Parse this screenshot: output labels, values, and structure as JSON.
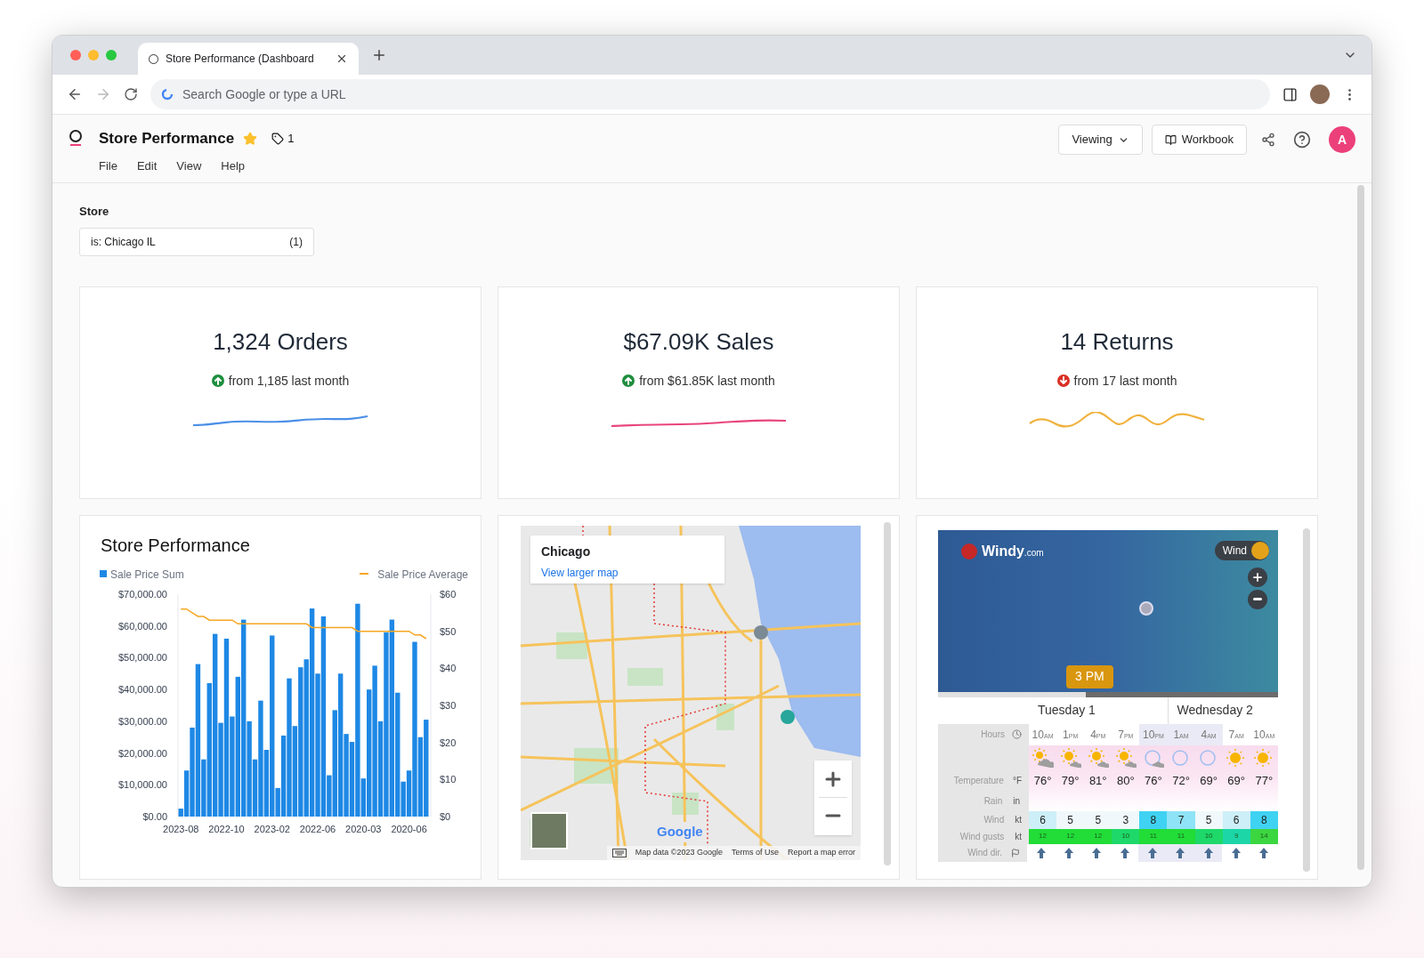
{
  "browser": {
    "tab_title": "Store Performance (Dashboard",
    "address_placeholder": "Search Google or type a URL"
  },
  "app": {
    "title": "Store Performance",
    "favorite": true,
    "tag_count": "1",
    "menu": [
      "File",
      "Edit",
      "View",
      "Help"
    ],
    "viewing": "Viewing",
    "workbook": "Workbook",
    "avatar": "A"
  },
  "filter": {
    "label": "Store",
    "value": "is: Chicago IL",
    "count": "(1)"
  },
  "kpis": [
    {
      "value": "1,324 Orders",
      "kind": "up",
      "comparison": "from 1,185 last month",
      "color": "#4a8fe7"
    },
    {
      "value": "$67.09K Sales",
      "kind": "up",
      "comparison": "from $61.85K last month",
      "color": "#e8457a"
    },
    {
      "value": "14 Returns",
      "kind": "down",
      "comparison": "from 17 last month",
      "color": "#f0b23e"
    }
  ],
  "chart_card": {
    "title": "Store Performance",
    "chart_data": {
      "type": "bar",
      "legend": "top",
      "ylim": [
        0,
        70000
      ],
      "y2lim": [
        0,
        60
      ],
      "categories": [
        "2023-08",
        null,
        null,
        null,
        null,
        null,
        null,
        null,
        "2022-10",
        null,
        null,
        null,
        null,
        null,
        null,
        null,
        "2023-02",
        null,
        null,
        null,
        null,
        null,
        null,
        null,
        "2022-06",
        null,
        null,
        null,
        null,
        null,
        null,
        null,
        "2020-03",
        null,
        null,
        null,
        null,
        null,
        null,
        null,
        "2020-06",
        null,
        null,
        null
      ],
      "yticks": [
        {
          "value": 0,
          "label": "$0.00"
        },
        {
          "value": 10000,
          "label": "$10,000.00"
        },
        {
          "value": 20000,
          "label": "$20,000.00"
        },
        {
          "value": 30000,
          "label": "$30,000.00"
        },
        {
          "value": 40000,
          "label": "$40,000.00"
        },
        {
          "value": 50000,
          "label": "$50,000.00"
        },
        {
          "value": 60000,
          "label": "$60,000.00"
        },
        {
          "value": 70000,
          "label": "$70,000.00"
        }
      ],
      "y2ticks": [
        {
          "value": 0,
          "label": "$0"
        },
        {
          "value": 10,
          "label": "$10"
        },
        {
          "value": 20,
          "label": "$20"
        },
        {
          "value": 30,
          "label": "$30"
        },
        {
          "value": 40,
          "label": "$40"
        },
        {
          "value": 50,
          "label": "$50"
        },
        {
          "value": 60,
          "label": "$60"
        }
      ],
      "series": [
        {
          "name": "Sale Price Sum",
          "color": "#1e88e5",
          "values": [
            2500,
            14500,
            28000,
            48000,
            18000,
            42000,
            57500,
            29500,
            56000,
            31500,
            44000,
            62000,
            30000,
            18000,
            36500,
            21000,
            57000,
            9000,
            25500,
            43500,
            28500,
            47000,
            49500,
            65500,
            45000,
            63000,
            13000,
            33500,
            45000,
            26000,
            23500,
            67000,
            12000,
            40000,
            47500,
            30000,
            58000,
            62000,
            39000,
            11000,
            14500,
            55000,
            25000,
            30500
          ]
        },
        {
          "name": "Sale Price Average",
          "color": "#f5a623",
          "type": "line",
          "axis": "y2",
          "values": [
            56,
            56,
            55,
            54,
            54,
            53,
            53,
            53,
            53,
            53,
            52,
            52,
            52,
            52,
            52,
            52,
            52,
            52,
            52,
            52,
            52,
            52,
            52,
            51,
            51,
            51,
            51,
            51,
            51,
            51,
            51,
            50,
            50,
            50,
            50,
            50,
            50,
            50,
            50,
            50,
            50,
            49,
            49,
            48
          ]
        }
      ]
    }
  },
  "map_card": {
    "place": "Chicago",
    "link": "View larger map",
    "logo": "Google",
    "footer": [
      "Map data ©2023 Google",
      "Terms of Use",
      "Report a map error"
    ]
  },
  "weather": {
    "brand": "Windy",
    "brand_suffix": ".com",
    "layer": "Wind",
    "time": "3 PM",
    "labels": {
      "hours": "Hours",
      "temperature": "Temperature",
      "temp_unit": "°F",
      "rain": "Rain",
      "rain_unit": "in",
      "wind": "Wind",
      "wind_unit": "kt",
      "gusts": "Wind gusts",
      "gusts_unit": "kt",
      "direction": "Wind dir."
    },
    "days": [
      {
        "label": "Tuesday 1",
        "hours": [
          {
            "hour": "10",
            "suffix": "AM",
            "kind": "cloudy-sun",
            "temp": "76°",
            "wind": "6",
            "gust": "12",
            "night": false
          },
          {
            "hour": "1",
            "suffix": "PM",
            "kind": "sun-cloud",
            "temp": "79°",
            "wind": "5",
            "gust": "12",
            "night": false
          },
          {
            "hour": "4",
            "suffix": "PM",
            "kind": "sun-cloud",
            "temp": "81°",
            "wind": "5",
            "gust": "12",
            "night": false
          },
          {
            "hour": "7",
            "suffix": "PM",
            "kind": "sun-cloud",
            "temp": "80°",
            "wind": "3",
            "gust": "10",
            "night": false
          },
          {
            "hour": "10",
            "suffix": "PM",
            "kind": "night-cloud",
            "temp": "76°",
            "wind": "8",
            "gust": "11",
            "night": true
          }
        ]
      },
      {
        "label": "Wednesday 2",
        "hours": [
          {
            "hour": "1",
            "suffix": "AM",
            "kind": "night",
            "temp": "72°",
            "wind": "7",
            "gust": "11",
            "night": true
          },
          {
            "hour": "4",
            "suffix": "AM",
            "kind": "night",
            "temp": "69°",
            "wind": "5",
            "gust": "10",
            "night": true
          },
          {
            "hour": "7",
            "suffix": "AM",
            "kind": "sun",
            "temp": "69°",
            "wind": "6",
            "gust": "9",
            "night": false
          },
          {
            "hour": "10",
            "suffix": "AM",
            "kind": "sun",
            "temp": "77°",
            "wind": "8",
            "gust": "14",
            "night": false
          }
        ]
      }
    ]
  }
}
